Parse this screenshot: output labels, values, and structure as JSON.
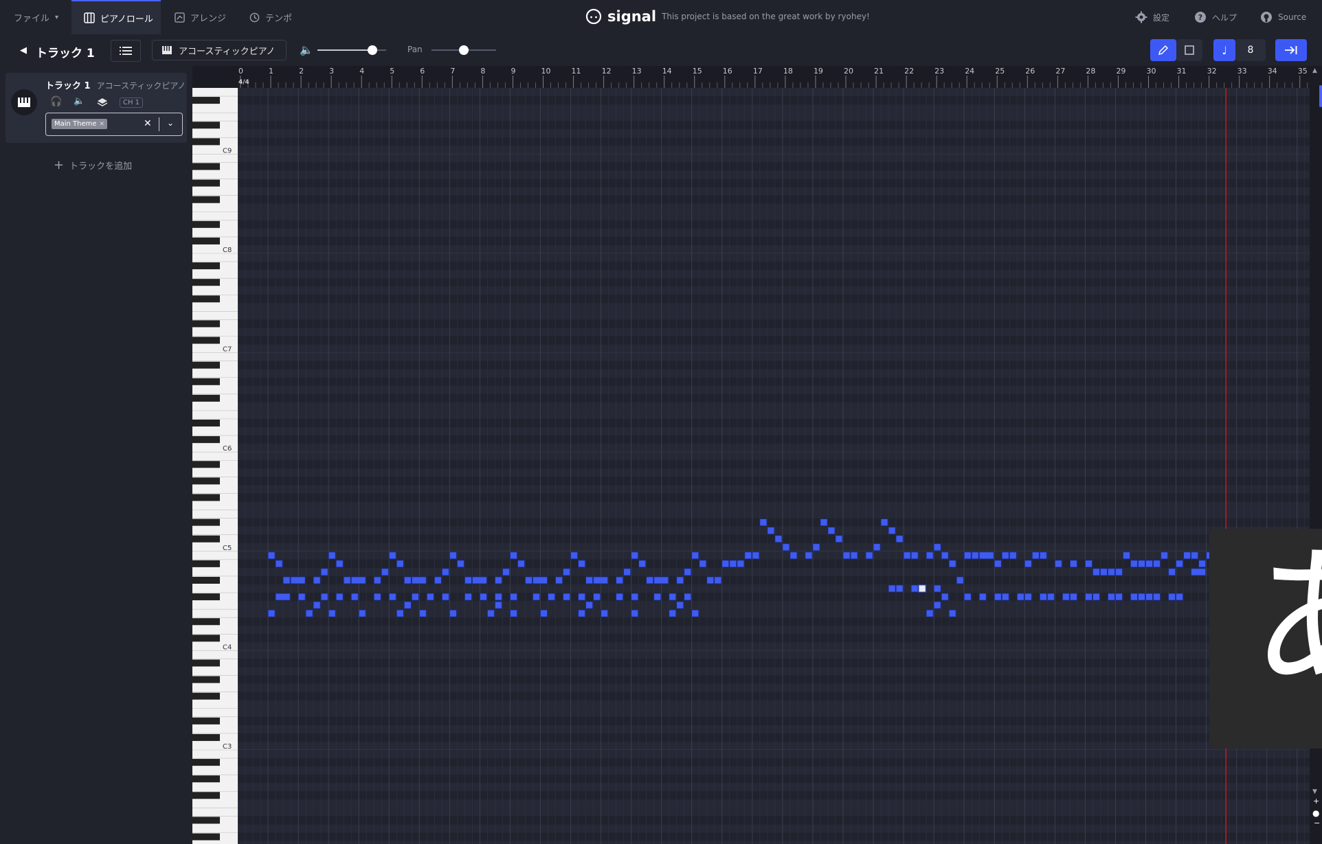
{
  "topbar": {
    "file_menu": "ファイル",
    "tabs": [
      "ピアノロール",
      "アレンジ",
      "テンポ"
    ],
    "app_name": "signal",
    "tagline": "This project is based on the great work by ryohey!",
    "settings": "設定",
    "help": "ヘルプ",
    "source": "Source"
  },
  "toolbar": {
    "track_title": "トラック 1",
    "instrument": "アコースティックピアノ",
    "pan_label": "Pan",
    "quantize_value": "8",
    "volume_level": 0.8,
    "pan_level": 0.5
  },
  "sidebar": {
    "track_name": "トラック 1",
    "track_instrument": "アコースティックピアノ",
    "channel": "CH 1",
    "tag": "Main Theme",
    "add_track": "トラックを追加"
  },
  "ruler": {
    "time_signature": "4/4",
    "bars": [
      "0",
      "1",
      "2",
      "3",
      "4",
      "5",
      "6",
      "7",
      "8",
      "9",
      "10",
      "11",
      "12",
      "13",
      "14",
      "15",
      "16",
      "17",
      "18",
      "19",
      "20",
      "21",
      "22",
      "23",
      "24",
      "25",
      "26",
      "27",
      "28",
      "29",
      "30",
      "31",
      "32",
      "33",
      "34",
      "35"
    ]
  },
  "piano": {
    "octave_labels": [
      "C9",
      "C8",
      "C7",
      "C6",
      "C5",
      "C4",
      "C3"
    ]
  },
  "ime": {
    "glyph": "あ"
  },
  "colors": {
    "note": "#3f5bf0",
    "accent": "#3d59f5",
    "playhead": "#b62020",
    "background": "#1e2029"
  },
  "notes": [
    [
      1.0,
      71,
      0.25
    ],
    [
      1.25,
      70,
      0.25
    ],
    [
      1.5,
      68,
      0.25
    ],
    [
      1.75,
      68,
      0.5
    ],
    [
      2.5,
      68,
      0.25
    ],
    [
      2.75,
      69,
      0.25
    ],
    [
      3.0,
      71,
      0.25
    ],
    [
      3.25,
      70,
      0.25
    ],
    [
      3.5,
      68,
      0.25
    ],
    [
      3.75,
      68,
      0.5
    ],
    [
      4.5,
      68,
      0.25
    ],
    [
      4.75,
      69,
      0.25
    ],
    [
      5.0,
      71,
      0.25
    ],
    [
      5.25,
      70,
      0.25
    ],
    [
      5.5,
      68,
      0.25
    ],
    [
      5.75,
      68,
      0.5
    ],
    [
      6.5,
      68,
      0.25
    ],
    [
      6.75,
      69,
      0.25
    ],
    [
      7.0,
      71,
      0.25
    ],
    [
      7.25,
      70,
      0.25
    ],
    [
      7.5,
      68,
      0.25
    ],
    [
      7.75,
      68,
      0.5
    ],
    [
      8.5,
      68,
      0.25
    ],
    [
      8.75,
      69,
      0.25
    ],
    [
      9.0,
      71,
      0.25
    ],
    [
      9.25,
      70,
      0.25
    ],
    [
      9.5,
      68,
      0.25
    ],
    [
      9.75,
      68,
      0.5
    ],
    [
      10.5,
      68,
      0.25
    ],
    [
      10.75,
      69,
      0.25
    ],
    [
      11.0,
      71,
      0.25
    ],
    [
      11.25,
      70,
      0.25
    ],
    [
      11.5,
      68,
      0.25
    ],
    [
      11.75,
      68,
      0.5
    ],
    [
      12.5,
      68,
      0.25
    ],
    [
      12.75,
      69,
      0.25
    ],
    [
      13.0,
      71,
      0.25
    ],
    [
      13.25,
      70,
      0.25
    ],
    [
      13.5,
      68,
      0.25
    ],
    [
      13.75,
      68,
      0.5
    ],
    [
      14.5,
      68,
      0.25
    ],
    [
      14.75,
      69,
      0.25
    ],
    [
      15.0,
      71,
      0.25
    ],
    [
      15.25,
      70,
      0.25
    ],
    [
      15.5,
      68,
      0.25
    ],
    [
      15.75,
      68,
      0.25
    ],
    [
      16.0,
      70,
      0.25
    ],
    [
      16.25,
      70,
      0.25
    ],
    [
      16.5,
      70,
      0.25
    ],
    [
      16.75,
      71,
      0.25
    ],
    [
      17.0,
      71,
      0.25
    ],
    [
      17.25,
      75,
      0.25
    ],
    [
      17.5,
      74,
      0.25
    ],
    [
      17.75,
      73,
      0.25
    ],
    [
      18.0,
      72,
      0.25
    ],
    [
      18.25,
      71,
      0.25
    ],
    [
      18.75,
      71,
      0.25
    ],
    [
      19.0,
      72,
      0.25
    ],
    [
      19.25,
      75,
      0.25
    ],
    [
      19.5,
      74,
      0.25
    ],
    [
      19.75,
      73,
      0.25
    ],
    [
      20.0,
      71,
      0.25
    ],
    [
      20.25,
      71,
      0.25
    ],
    [
      20.75,
      71,
      0.25
    ],
    [
      21.0,
      72,
      0.25
    ],
    [
      21.25,
      75,
      0.25
    ],
    [
      21.5,
      74,
      0.25
    ],
    [
      21.75,
      73,
      0.25
    ],
    [
      22.0,
      71,
      0.25
    ],
    [
      22.25,
      71,
      0.25
    ],
    [
      22.75,
      71,
      0.25
    ],
    [
      23.0,
      72,
      0.25
    ],
    [
      23.25,
      71,
      0.25
    ],
    [
      23.5,
      70,
      0.25
    ],
    [
      23.75,
      68,
      0.25
    ],
    [
      24.0,
      71,
      0.25
    ],
    [
      24.25,
      71,
      0.25
    ],
    [
      24.5,
      71,
      0.5
    ],
    [
      25.0,
      70,
      0.25
    ],
    [
      25.25,
      71,
      0.25
    ],
    [
      25.5,
      71,
      0.25
    ],
    [
      26.0,
      70,
      0.25
    ],
    [
      26.25,
      71,
      0.25
    ],
    [
      26.5,
      71,
      0.25
    ],
    [
      27.0,
      70,
      0.25
    ],
    [
      27.5,
      70,
      0.25
    ],
    [
      28.0,
      70,
      0.25
    ],
    [
      28.25,
      69,
      0.25
    ],
    [
      28.5,
      69,
      0.25
    ],
    [
      28.75,
      69,
      0.25
    ],
    [
      29.0,
      69,
      0.25
    ],
    [
      29.25,
      71,
      0.25
    ],
    [
      29.5,
      70,
      0.25
    ],
    [
      29.75,
      70,
      0.25
    ],
    [
      30.0,
      70,
      0.25
    ],
    [
      30.25,
      70,
      0.25
    ],
    [
      30.5,
      71,
      0.25
    ],
    [
      30.75,
      69,
      0.25
    ],
    [
      31.0,
      70,
      0.25
    ],
    [
      31.25,
      71,
      0.25
    ],
    [
      31.5,
      71,
      0.25
    ],
    [
      31.75,
      70,
      0.25
    ],
    [
      32.0,
      71,
      0.25
    ],
    [
      32.25,
      71,
      0.25
    ],
    [
      32.5,
      71,
      0.25
    ],
    [
      32.75,
      71,
      0.25
    ],
    [
      1.25,
      66,
      0.5
    ],
    [
      2.0,
      66,
      0.25
    ],
    [
      2.75,
      66,
      0.25
    ],
    [
      3.25,
      66,
      0.25
    ],
    [
      3.75,
      66,
      0.25
    ],
    [
      4.5,
      66,
      0.25
    ],
    [
      5.0,
      66,
      0.25
    ],
    [
      5.75,
      66,
      0.25
    ],
    [
      6.25,
      66,
      0.25
    ],
    [
      6.75,
      66,
      0.25
    ],
    [
      7.5,
      66,
      0.25
    ],
    [
      8.0,
      66,
      0.25
    ],
    [
      8.5,
      66,
      0.25
    ],
    [
      9.0,
      66,
      0.25
    ],
    [
      9.75,
      66,
      0.25
    ],
    [
      10.25,
      66,
      0.25
    ],
    [
      10.75,
      66,
      0.25
    ],
    [
      11.25,
      66,
      0.25
    ],
    [
      11.75,
      66,
      0.25
    ],
    [
      12.5,
      66,
      0.25
    ],
    [
      13.0,
      66,
      0.25
    ],
    [
      13.75,
      66,
      0.25
    ],
    [
      14.25,
      66,
      0.25
    ],
    [
      14.75,
      66,
      0.25
    ],
    [
      1.0,
      64,
      0.25
    ],
    [
      2.25,
      64,
      0.25
    ],
    [
      3.0,
      64,
      0.25
    ],
    [
      4.0,
      64,
      0.25
    ],
    [
      5.25,
      64,
      0.25
    ],
    [
      6.0,
      64,
      0.25
    ],
    [
      7.0,
      64,
      0.25
    ],
    [
      8.25,
      64,
      0.25
    ],
    [
      9.0,
      64,
      0.25
    ],
    [
      10.0,
      64,
      0.25
    ],
    [
      11.25,
      64,
      0.25
    ],
    [
      12.0,
      64,
      0.25
    ],
    [
      13.0,
      64,
      0.25
    ],
    [
      14.25,
      64,
      0.25
    ],
    [
      15.0,
      64,
      0.25
    ],
    [
      2.5,
      65,
      0.25
    ],
    [
      5.5,
      65,
      0.25
    ],
    [
      8.5,
      65,
      0.25
    ],
    [
      11.5,
      65,
      0.25
    ],
    [
      14.5,
      65,
      0.25
    ],
    [
      23.0,
      65,
      0.25
    ],
    [
      23.25,
      66,
      0.25
    ],
    [
      23.5,
      64,
      0.25
    ],
    [
      24.0,
      66,
      0.25
    ],
    [
      24.5,
      66,
      0.25
    ],
    [
      25.0,
      66,
      0.25
    ],
    [
      25.25,
      66,
      0.25
    ],
    [
      25.75,
      66,
      0.25
    ],
    [
      26.0,
      66,
      0.25
    ],
    [
      26.5,
      66,
      0.25
    ],
    [
      26.75,
      66,
      0.25
    ],
    [
      27.25,
      66,
      0.25
    ],
    [
      27.5,
      66,
      0.25
    ],
    [
      28.0,
      66,
      0.25
    ],
    [
      28.25,
      66,
      0.25
    ],
    [
      28.75,
      66,
      0.25
    ],
    [
      29.0,
      66,
      0.25
    ],
    [
      29.5,
      66,
      0.25
    ],
    [
      29.75,
      66,
      0.25
    ],
    [
      30.0,
      66,
      0.25
    ],
    [
      30.25,
      66,
      0.25
    ],
    [
      30.75,
      66,
      0.25
    ],
    [
      31.0,
      66,
      0.25
    ],
    [
      31.5,
      69,
      0.5
    ],
    [
      21.75,
      67,
      0.25
    ],
    [
      21.5,
      67,
      0.25
    ],
    [
      22.25,
      67,
      0.25
    ],
    [
      22.75,
      64,
      0.25
    ],
    [
      23.0,
      67,
      0.25
    ]
  ],
  "selected_note": [
    22.5,
    67,
    0.25
  ]
}
